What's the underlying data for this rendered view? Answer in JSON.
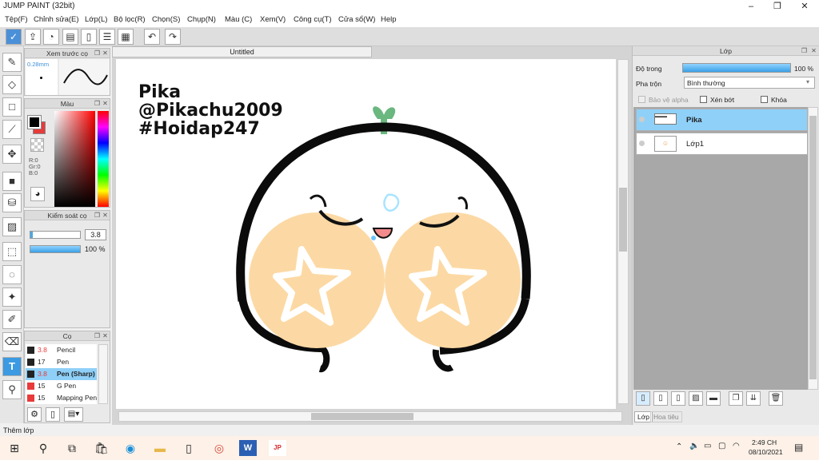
{
  "window": {
    "title": "JUMP PAINT (32bit)",
    "min": "–",
    "max": "❐",
    "close": "✕"
  },
  "menu": [
    "Tệp(F)",
    "Chỉnh sửa(E)",
    "Lớp(L)",
    "Bộ lọc(R)",
    "Chọn(S)",
    "Chụp(N)",
    "Màu (C)",
    "Xem(V)",
    "Công cụ(T)",
    "Cửa sổ(W)",
    "Help"
  ],
  "document": {
    "tab": "Untitled"
  },
  "drawing": {
    "line1": "Pika",
    "line2": "@Pikachu2009",
    "line3": "#Hoidap247"
  },
  "brush_preview": {
    "title": "Xem trước cọ",
    "size": "0.28mm"
  },
  "color_panel": {
    "title": "Màu",
    "r": "R:0",
    "g": "Gr:0",
    "b": "B:0",
    "fg": "#000000",
    "bg": "#e83a3a"
  },
  "brush_control": {
    "title": "Kiểm soát cọ",
    "size": "3.8",
    "opacity": "100 %"
  },
  "brush_panel": {
    "title": "Cọ",
    "items": [
      {
        "size": "3.8",
        "name": "Pencil",
        "color": "#222222",
        "red": true
      },
      {
        "size": "17",
        "name": "Pen",
        "color": "#222222",
        "red": false
      },
      {
        "size": "3.8",
        "name": "Pen (Sharp)",
        "color": "#222222",
        "red": true,
        "selected": true
      },
      {
        "size": "15",
        "name": "G Pen",
        "color": "#e83a3a",
        "red": false
      },
      {
        "size": "15",
        "name": "Mapping Pen",
        "color": "#e83a3a",
        "red": false
      }
    ]
  },
  "layer_panel": {
    "title": "Lớp",
    "opacity_label": "Độ trong",
    "opacity_value": "100 %",
    "blend_label": "Pha trộn",
    "blend_value": "Bình thường",
    "protect_alpha": "Bảo vệ alpha",
    "clip": "Xén bớt",
    "lock": "Khóa",
    "layers": [
      {
        "name": "Pika",
        "selected": true
      },
      {
        "name": "Lớp1",
        "selected": false
      }
    ],
    "tabs": [
      "Lớp",
      "Hoa tiêu"
    ]
  },
  "status": {
    "text": "Thêm lớp"
  },
  "taskbar": {
    "time": "2:49 CH",
    "date": "08/10/2021"
  },
  "icons": [
    "windows-icon",
    "search-icon",
    "task-view-icon",
    "store-icon",
    "edge-icon",
    "folder-icon",
    "file-icon",
    "chrome-icon",
    "word-icon",
    "jump-paint-icon"
  ]
}
